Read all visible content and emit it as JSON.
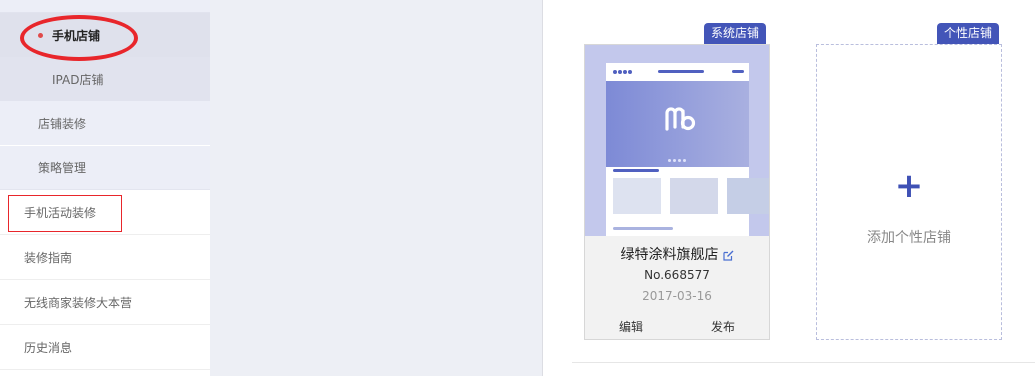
{
  "sidebar": {
    "items": [
      {
        "label": "手机店铺"
      },
      {
        "label": "IPAD店铺"
      },
      {
        "label": "店铺装修"
      },
      {
        "label": "策略管理"
      },
      {
        "label": "手机活动装修"
      },
      {
        "label": "装修指南"
      },
      {
        "label": "无线商家装修大本营"
      },
      {
        "label": "历史消息"
      }
    ]
  },
  "shop_card": {
    "badge": "系统店铺",
    "name": "绿特涂料旗舰店",
    "number": "No.668577",
    "date": "2017-03-16",
    "edit_label": "编辑",
    "publish_label": "发布"
  },
  "add_card": {
    "badge": "个性店铺",
    "plus": "+",
    "label": "添加个性店铺"
  },
  "colors": {
    "accent": "#4355b8",
    "annotation_red": "#e8262b",
    "active_dot": "#e04a4a"
  },
  "icons": {
    "edit": "edit-icon",
    "add": "plus-icon",
    "logo": "mobile-logo-icon"
  }
}
